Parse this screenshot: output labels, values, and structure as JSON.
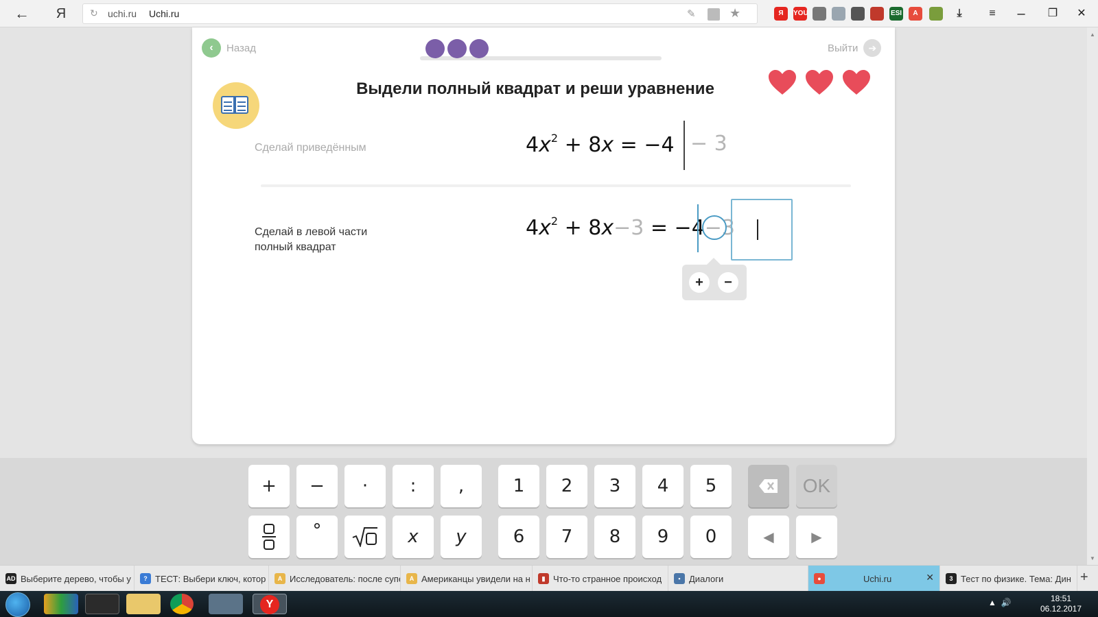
{
  "browser": {
    "url_domain": "uchi.ru",
    "page_title": "Uchi.ru",
    "yandex_letter": "Я",
    "extensions": [
      {
        "name": "yandex-ext-icon",
        "label": "Я",
        "color": "#e52620"
      },
      {
        "name": "youtube-ext-icon",
        "label": "YOU",
        "color": "#e52620"
      },
      {
        "name": "bulb-ext-icon",
        "label": "",
        "color": "#777777"
      },
      {
        "name": "download-ext-icon",
        "label": "",
        "color": "#9aa6b0"
      },
      {
        "name": "map-pin-ext-icon",
        "label": "",
        "color": "#555555"
      },
      {
        "name": "bug-ext-icon",
        "label": "",
        "color": "#c0392b"
      },
      {
        "name": "esi-ext-icon",
        "label": "ESI",
        "color": "#1b6b2e"
      },
      {
        "name": "a-ext-icon",
        "label": "A",
        "color": "#e74c3c"
      },
      {
        "name": "picture-ext-icon",
        "label": "",
        "color": "#7a9d3c"
      },
      {
        "name": "downloads-icon",
        "label": "⤓",
        "color": "#333333"
      }
    ]
  },
  "nav": {
    "back_label": "Назад",
    "exit_label": "Выйти"
  },
  "progress": {
    "completed": 3
  },
  "lives": 3,
  "task_title": "Выдели полный квадрат и реши уравнение",
  "step1": {
    "label": "Сделай приведённым",
    "coef": "4",
    "var": "x",
    "exp": "2",
    "plus": " + 8",
    "var2": "x",
    "rhs": " = −4",
    "operation": "− 3"
  },
  "step2": {
    "label": "Сделай в левой части полный квадрат",
    "coef": "4",
    "var": "x",
    "exp": "2",
    "plus": " + 8",
    "var2": "x",
    "grey1": "−3",
    "rhs": " = −4",
    "grey2": "−3",
    "op_plus": "+",
    "op_minus": "−"
  },
  "keyboard": {
    "row1": [
      "+",
      "−",
      "·",
      ":",
      ",",
      "1",
      "2",
      "3",
      "4",
      "5"
    ],
    "row2_digits": [
      "6",
      "7",
      "8",
      "9",
      "0"
    ],
    "x_key": "x",
    "y_key": "y",
    "degree_key": "°",
    "ok_label": "OK",
    "left_arrow": "◀",
    "right_arrow": "▶"
  },
  "tabs": [
    {
      "label": "Выберите дерево, чтобы у",
      "icon": "AD",
      "icon_color": "#222222"
    },
    {
      "label": "ТЕСТ: Выбери ключ, котор",
      "icon": "?",
      "icon_color": "#3a7bd5"
    },
    {
      "label": "Исследователь: после супе",
      "icon": "A",
      "icon_color": "#e8b64a"
    },
    {
      "label": "Американцы увидели на н",
      "icon": "A",
      "icon_color": "#e8b64a"
    },
    {
      "label": "Что-то странное происход",
      "icon": "▮",
      "icon_color": "#c0392b"
    },
    {
      "label": "Диалоги",
      "icon": "▪",
      "icon_color": "#4a76a8"
    },
    {
      "label": "Uchi.ru",
      "icon": "●",
      "icon_color": "#e74c3c",
      "active": true
    },
    {
      "label": "Тест по физике. Тема: Дин",
      "icon": "3",
      "icon_color": "#222222"
    }
  ],
  "taskbar": {
    "time": "18:51",
    "date": "06.12.2017"
  }
}
